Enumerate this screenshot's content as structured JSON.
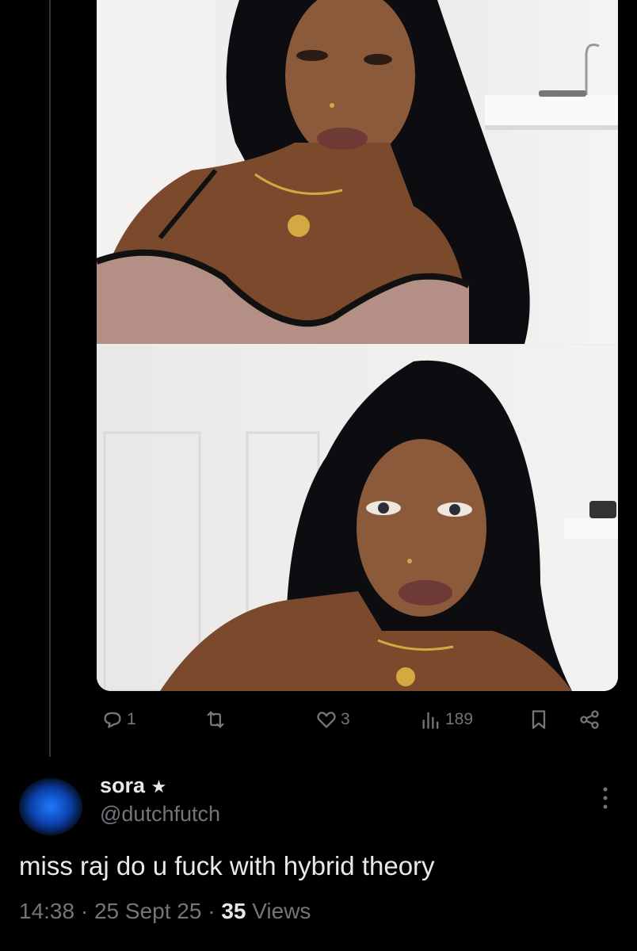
{
  "post": {
    "media": [
      {
        "alt": "photo-1"
      },
      {
        "alt": "photo-2"
      }
    ],
    "actions": {
      "reply_count": "1",
      "like_count": "3",
      "view_count": "189"
    }
  },
  "reply": {
    "display_name": "sora",
    "name_symbol": "★",
    "handle": "@dutchfutch",
    "text": "miss raj do u fuck with hybrid theory",
    "time": "14:38",
    "date": "25 Sept 25",
    "separator": "·",
    "views_count": "35",
    "views_label": "Views"
  },
  "colors": {
    "background": "#000000",
    "text_primary": "#e7e9ea",
    "text_secondary": "#71767b",
    "divider": "#333639"
  },
  "icons": [
    "reply-icon",
    "retweet-icon",
    "like-icon",
    "views-icon",
    "bookmark-icon",
    "share-icon",
    "more-icon"
  ]
}
